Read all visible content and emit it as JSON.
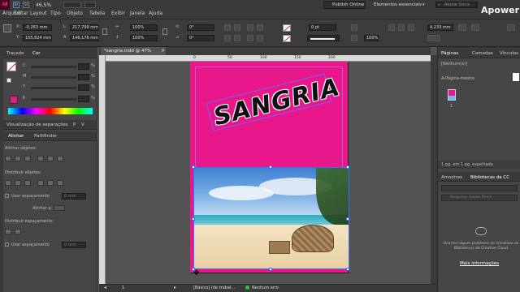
{
  "app": {
    "logo": "Id",
    "zoom": "46,5%",
    "menus": [
      "Arquivo",
      "Editar",
      "Layout",
      "Tipo",
      "Objeto",
      "Tabela",
      "Exibir",
      "Janela",
      "Ajuda"
    ],
    "publish_label": "Publish Online",
    "workspace_label": "Elementos essenciais",
    "search_placeholder": "Adobe Stock",
    "watermark": "ApowerRE"
  },
  "control": {
    "x_val": "-0,263 mm",
    "y_val": "155,824 mm",
    "w_val": "217,799 mm",
    "h_val": "146,176 mm",
    "scale_x": "100%",
    "scale_y": "100%",
    "rot": "0°",
    "shear": "0°",
    "stroke_w": "0 pt",
    "size_val": "4,233 mm",
    "pct_val": "100%"
  },
  "left_panel": {
    "tab_stroke": "Traçado",
    "tab_color": "Cor",
    "color_labels": [
      "C",
      "M",
      "Y",
      "K"
    ],
    "pct": "%",
    "sep_header": "Visualização de separações",
    "sep_extra": [
      "P",
      "V"
    ],
    "tab_align": "Alinhar",
    "tab_pathfinder": "Pathfinder",
    "align_objects": "Alinhar objetos:",
    "distribute_objects": "Distribuir objetos:",
    "use_spacing": "Usar espaçamento",
    "spacing_val": "0 mm",
    "align_to": "Alinhar a:",
    "distribute_spacing": "Distribuir espaçamento:",
    "use_spacing2": "Usar espaçamento",
    "spacing_val2": "0 mm"
  },
  "document": {
    "tab_title": "*sangria.indd @ 47%",
    "headline": "SANGRIA",
    "ruler_marks": [
      "0",
      "50",
      "100",
      "150",
      "200"
    ],
    "page_num": "1",
    "status_style": "[Básico] (de trabal...",
    "status_err": "Nenhum erro",
    "colors": {
      "page_bg": "#e8178a",
      "pasteboard": "#535353",
      "headline_fill": "#111111"
    }
  },
  "right_panel": {
    "tabs": [
      "Páginas",
      "Camadas",
      "Vínculos"
    ],
    "none_label": "[Nenhum(a)]",
    "master_label": "A-Página-mestre",
    "page_label": "1",
    "footer": "1 pg. em 1 pg. espelhada",
    "tabs2": [
      "Amostras",
      "Bibliotecas da CC"
    ],
    "cc_placeholder": "Pesquisar Adobe Stock",
    "cc_error": "Ocorreu algum problema ao inicializar as Bibliotecas da Creative Cloud",
    "cc_link": "Mais informações"
  }
}
